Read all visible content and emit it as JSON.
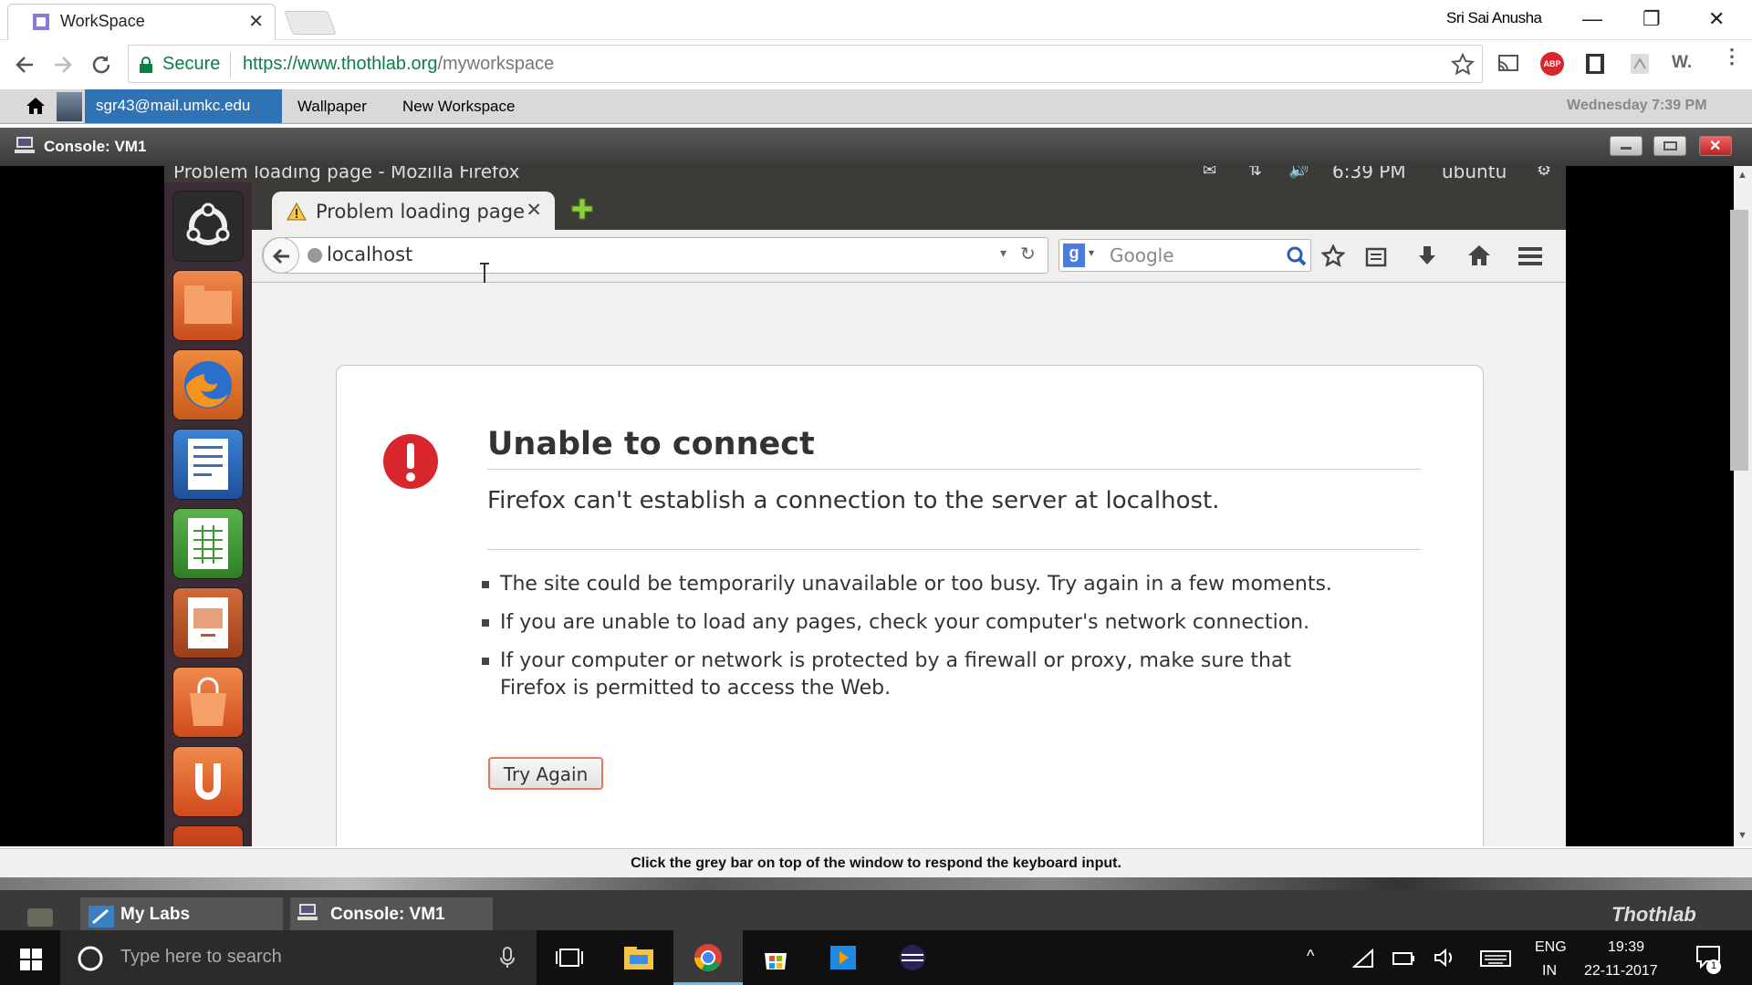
{
  "browser": {
    "tab_title": "WorkSpace",
    "tab_close": "✕",
    "profile_name": "Sri Sai Anusha",
    "secure_label": "Secure",
    "url_base": "https://www.thothlab.org",
    "url_path": "/myworkspace",
    "ext_abp": "ABP",
    "ext_w": "W."
  },
  "thothlab": {
    "user_email": "sgr43@mail.umkc.edu",
    "nav": [
      "Wallpaper",
      "New Workspace"
    ],
    "datetime": "Wednesday 7:39 PM"
  },
  "console": {
    "title": "Console: VM1"
  },
  "vm": {
    "window_title": "Problem loading page - Mozilla Firefox",
    "panel_time": "6:39 PM",
    "panel_user": "ubuntu",
    "firefox": {
      "tab_title": "Problem loading page",
      "url": "localhost",
      "search_placeholder": "Google",
      "error_title": "Unable to connect",
      "error_subtitle": "Firefox can't establish a connection to the server at localhost.",
      "bullets": [
        "The site could be temporarily unavailable or too busy. Try again in a few moments.",
        "If you are unable to load any pages, check your computer's network connection.",
        "If your computer or network is protected by a firewall or proxy, make sure that Firefox is permitted to access the Web."
      ],
      "try_again": "Try Again"
    }
  },
  "hint": "Click the grey bar on top of the window to respond the keyboard input.",
  "thoth_tabs": [
    "My Labs",
    "Console: VM1"
  ],
  "brand": "Thothlab",
  "taskbar": {
    "search_placeholder": "Type here to search",
    "lang_top": "ENG",
    "lang_bottom": "IN",
    "time": "19:39",
    "date": "22-11-2017",
    "notifications": "1"
  },
  "colors": {
    "accent": "#2f73b5",
    "secure_green": "#0b8043",
    "error_red": "#d9262c",
    "launcher_bg": "#3b2b34"
  }
}
